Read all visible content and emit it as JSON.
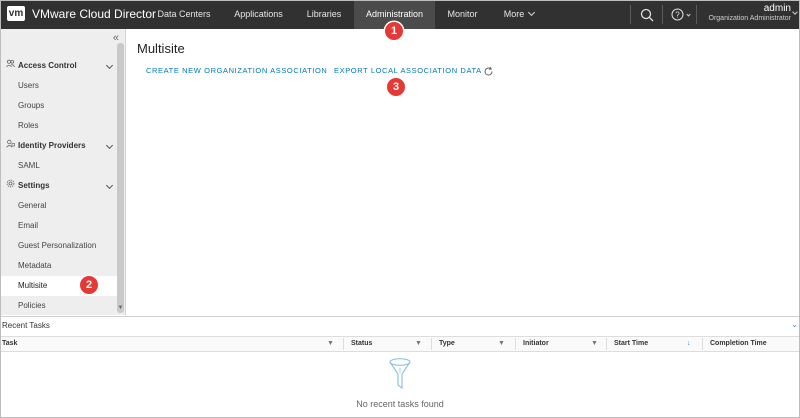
{
  "header": {
    "logo_text": "vm",
    "app_title": "VMware Cloud Director",
    "nav": [
      "Data Centers",
      "Applications",
      "Libraries",
      "Administration",
      "Monitor",
      "More"
    ],
    "active_nav": "Administration",
    "user_name": "admin",
    "user_role": "Organization Administrator"
  },
  "sidebar": {
    "groups": [
      {
        "label": "Access Control",
        "icon": "people-icon",
        "items": [
          "Users",
          "Groups",
          "Roles"
        ]
      },
      {
        "label": "Identity Providers",
        "icon": "id-icon",
        "items": [
          "SAML"
        ]
      },
      {
        "label": "Settings",
        "icon": "gear-icon",
        "items": [
          "General",
          "Email",
          "Guest Personalization",
          "Metadata",
          "Multisite",
          "Policies"
        ]
      }
    ],
    "active_item": "Multisite"
  },
  "main": {
    "title": "Multisite",
    "actions": [
      "CREATE NEW ORGANIZATION ASSOCIATION",
      "EXPORT LOCAL ASSOCIATION DATA"
    ]
  },
  "badges": [
    "1",
    "2",
    "3"
  ],
  "tasks": {
    "title": "Recent Tasks",
    "columns": [
      "Task",
      "Status",
      "Type",
      "Initiator",
      "Start Time",
      "Completion Time"
    ],
    "empty_text": "No recent tasks found"
  },
  "colors": {
    "header_bg": "#313131",
    "link": "#0079b8",
    "badge": "#e53935"
  }
}
